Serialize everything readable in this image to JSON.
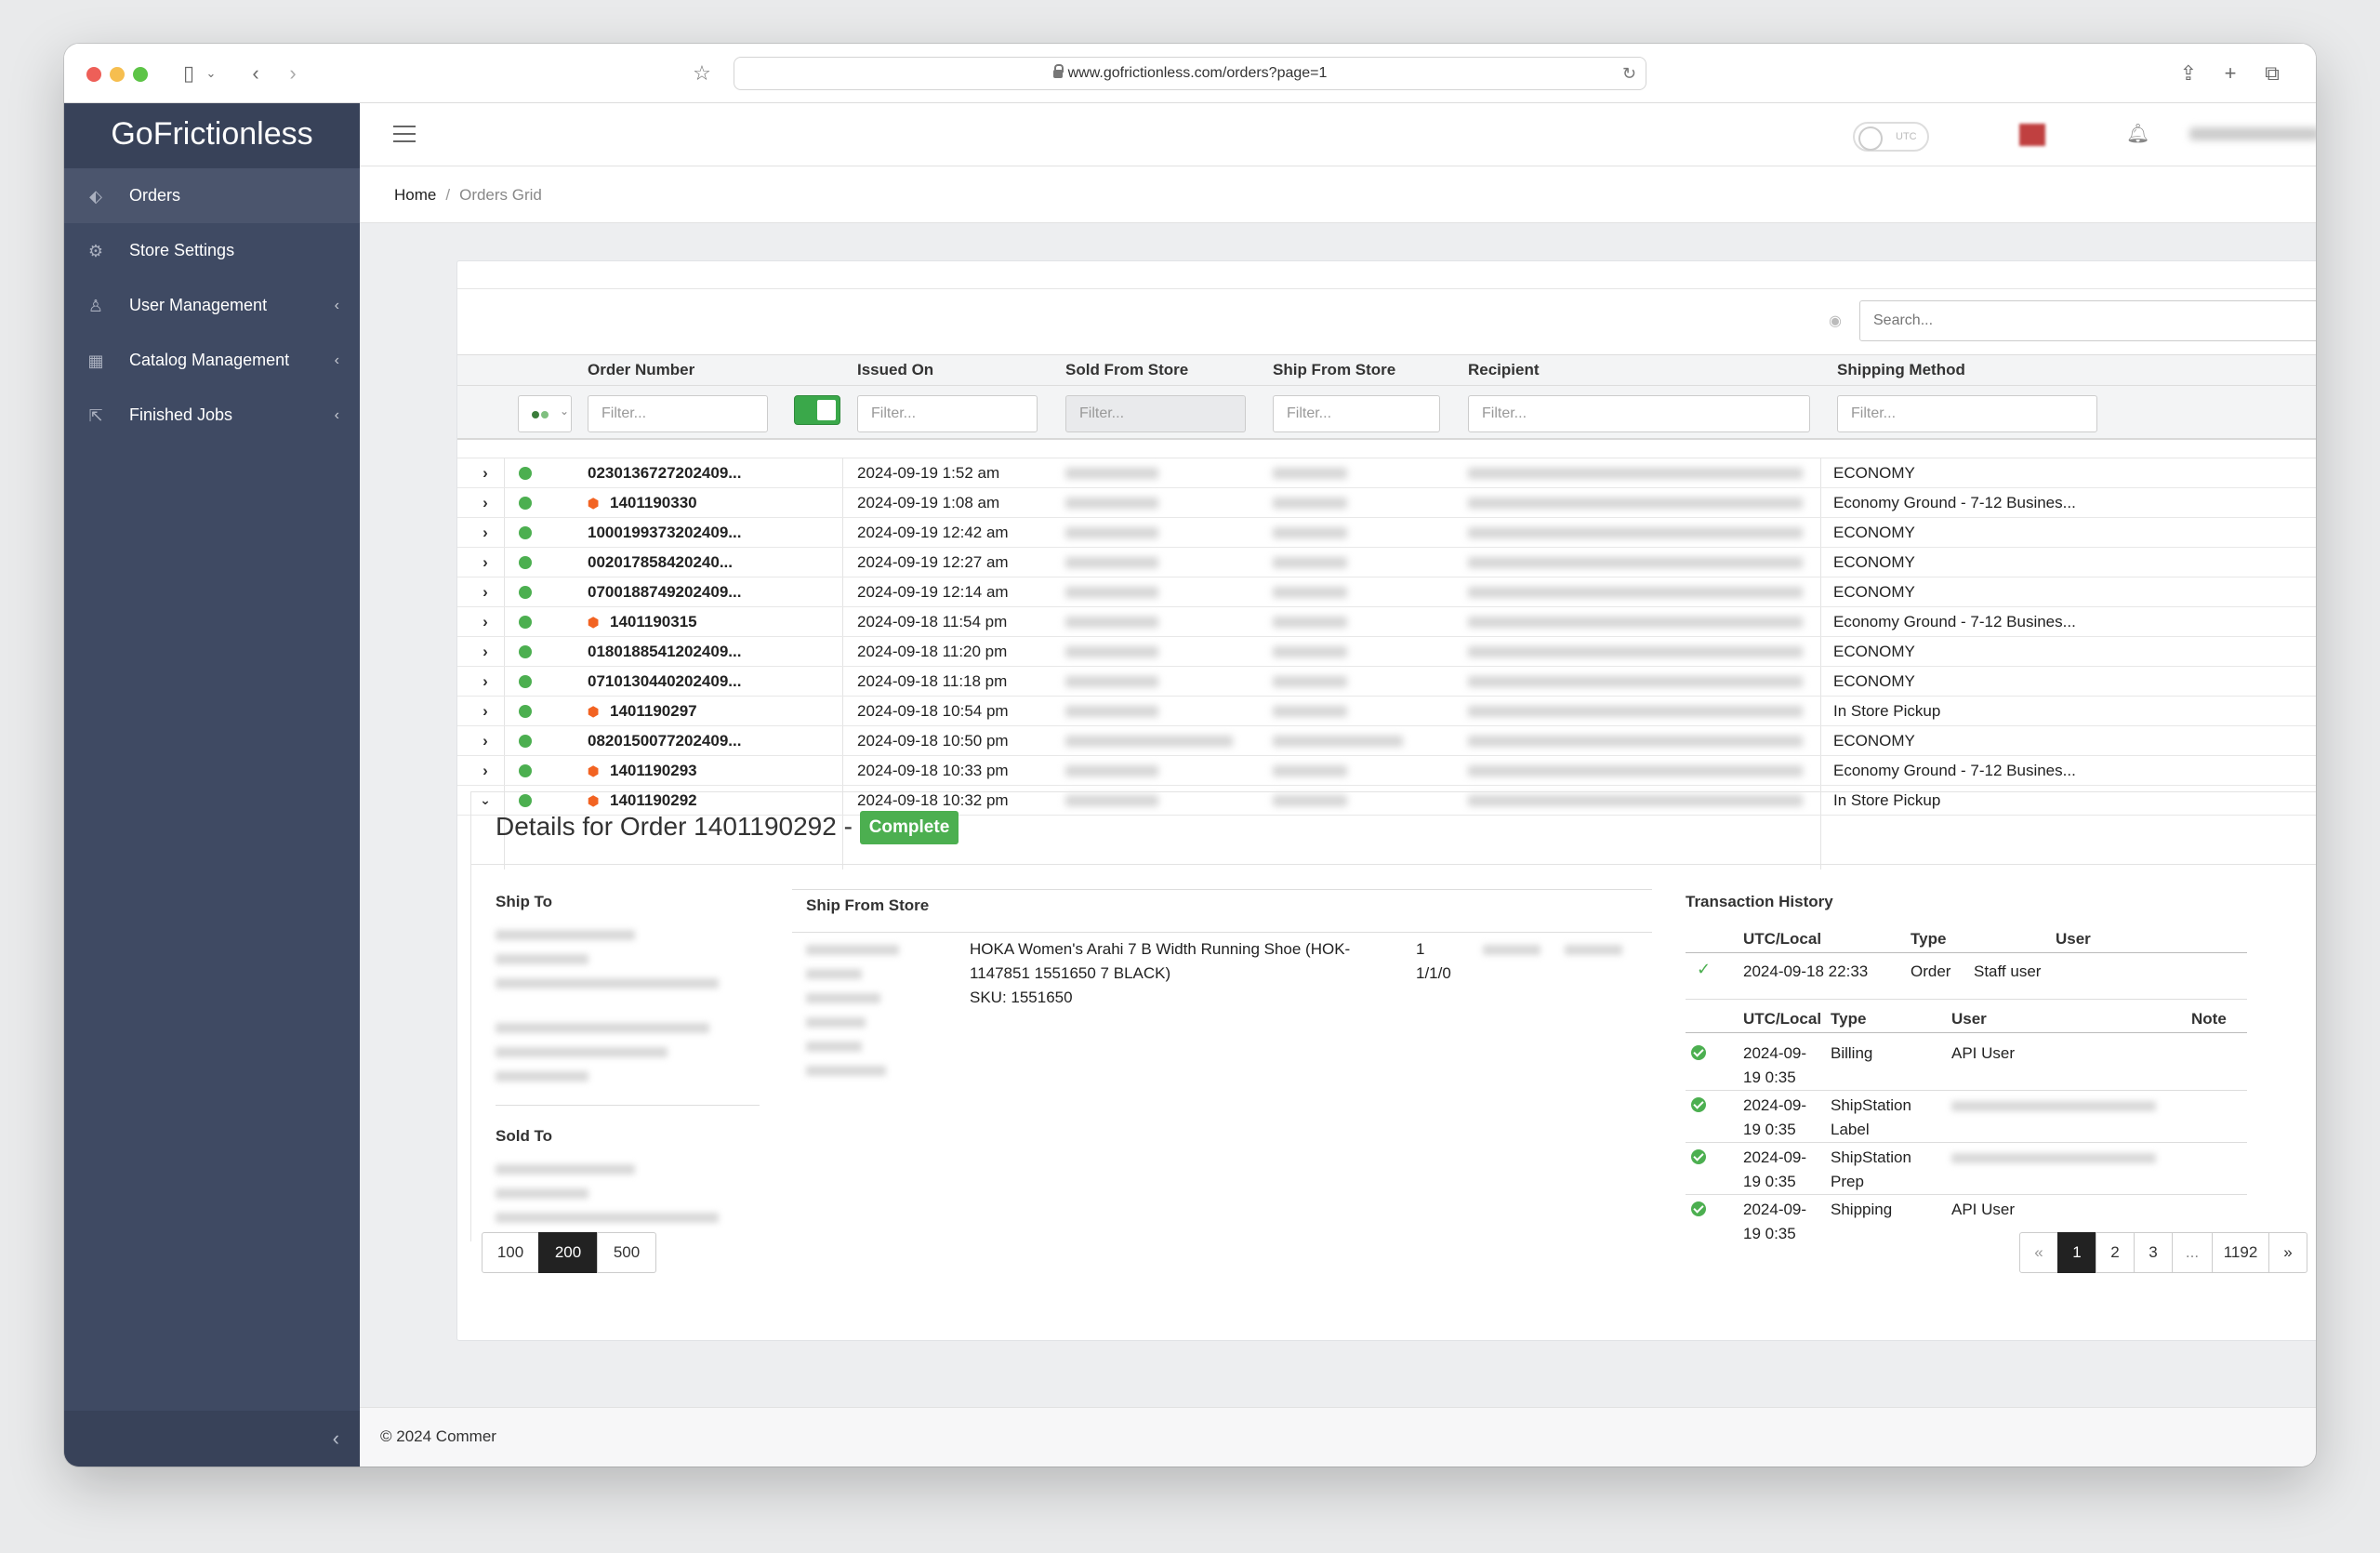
{
  "browser": {
    "url": "www.gofrictionless.com/orders?page=1"
  },
  "sidebar": {
    "brand": "GoFrictionless",
    "items": [
      {
        "label": "Orders",
        "icon": "tag-icon"
      },
      {
        "label": "Store Settings",
        "icon": "gear-icon"
      },
      {
        "label": "User Management",
        "icon": "user-icon"
      },
      {
        "label": "Catalog Management",
        "icon": "calendar-icon"
      },
      {
        "label": "Finished Jobs",
        "icon": "external-link-icon"
      }
    ]
  },
  "topnav": {
    "utc_label": "UTC"
  },
  "breadcrumb": {
    "home": "Home",
    "separator": "/",
    "current": "Orders Grid"
  },
  "grid": {
    "search_placeholder": "Search...",
    "columns": [
      "Order Number",
      "Issued On",
      "Sold From Store",
      "Ship From Store",
      "Recipient",
      "Shipping Method"
    ],
    "filter_placeholder": "Filter...",
    "rows": [
      {
        "order": "0230136727202409...",
        "issued": "2024-09-19 1:52 am",
        "method": "ECONOMY",
        "magento": false,
        "expanded": false
      },
      {
        "order": "1401190330",
        "issued": "2024-09-19 1:08 am",
        "method": "Economy Ground - 7-12 Busines...",
        "magento": true,
        "expanded": false
      },
      {
        "order": "1000199373202409...",
        "issued": "2024-09-19 12:42 am",
        "method": "ECONOMY",
        "magento": false,
        "expanded": false
      },
      {
        "order": "002017858420240...",
        "issued": "2024-09-19 12:27 am",
        "method": "ECONOMY",
        "magento": false,
        "expanded": false
      },
      {
        "order": "0700188749202409...",
        "issued": "2024-09-19 12:14 am",
        "method": "ECONOMY",
        "magento": false,
        "expanded": false
      },
      {
        "order": "1401190315",
        "issued": "2024-09-18 11:54 pm",
        "method": "Economy Ground - 7-12 Busines...",
        "magento": true,
        "expanded": false
      },
      {
        "order": "0180188541202409...",
        "issued": "2024-09-18 11:20 pm",
        "method": "ECONOMY",
        "magento": false,
        "expanded": false
      },
      {
        "order": "0710130440202409...",
        "issued": "2024-09-18 11:18 pm",
        "method": "ECONOMY",
        "magento": false,
        "expanded": false
      },
      {
        "order": "1401190297",
        "issued": "2024-09-18 10:54 pm",
        "method": "In Store Pickup",
        "magento": true,
        "expanded": false
      },
      {
        "order": "0820150077202409...",
        "issued": "2024-09-18 10:50 pm",
        "method": "ECONOMY",
        "magento": false,
        "expanded": false
      },
      {
        "order": "1401190293",
        "issued": "2024-09-18 10:33 pm",
        "method": "Economy Ground - 7-12 Busines...",
        "magento": true,
        "expanded": false
      },
      {
        "order": "1401190292",
        "issued": "2024-09-18 10:32 pm",
        "method": "In Store Pickup",
        "magento": true,
        "expanded": true
      }
    ]
  },
  "details": {
    "title": "Details for Order 1401190292 -",
    "status": "Complete",
    "ship_to": "Ship To",
    "sold_to": "Sold To",
    "ship_from_store": "Ship From Store",
    "item": {
      "description": "HOKA Women's Arahi 7 B Width Running Shoe (HOK-1147851 1551650 7 BLACK)",
      "sku": "SKU: 1551650",
      "qty": "1",
      "qty_detail": "1/1/0"
    },
    "transaction_history": {
      "title": "Transaction History",
      "headers1": [
        "UTC/Local",
        "Type",
        "User"
      ],
      "entry1": {
        "time": "2024-09-18 22:33",
        "type": "Order",
        "user": "Staff user"
      },
      "headers2": [
        "UTC/Local",
        "Type",
        "User",
        "Note"
      ],
      "entries": [
        {
          "date": "2024-09-",
          "time": "19 0:35",
          "type": "Billing",
          "type2": "",
          "user": "API User",
          "blur": false
        },
        {
          "date": "2024-09-",
          "time": "19 0:35",
          "type": "ShipStation",
          "type2": "Label",
          "user": "",
          "blur": true
        },
        {
          "date": "2024-09-",
          "time": "19 0:35",
          "type": "ShipStation",
          "type2": "Prep",
          "user": "",
          "blur": true
        },
        {
          "date": "2024-09-",
          "time": "19 0:35",
          "type": "Shipping",
          "type2": "",
          "user": "API User",
          "blur": false
        }
      ]
    }
  },
  "page_size": {
    "options": [
      "100",
      "200",
      "500"
    ],
    "selected": "200"
  },
  "pagination": {
    "prev": "«",
    "pages": [
      "1",
      "2",
      "3",
      "...",
      "1192"
    ],
    "next": "»",
    "current": "1"
  },
  "footer": {
    "copyright": "© 2024 Commer"
  }
}
